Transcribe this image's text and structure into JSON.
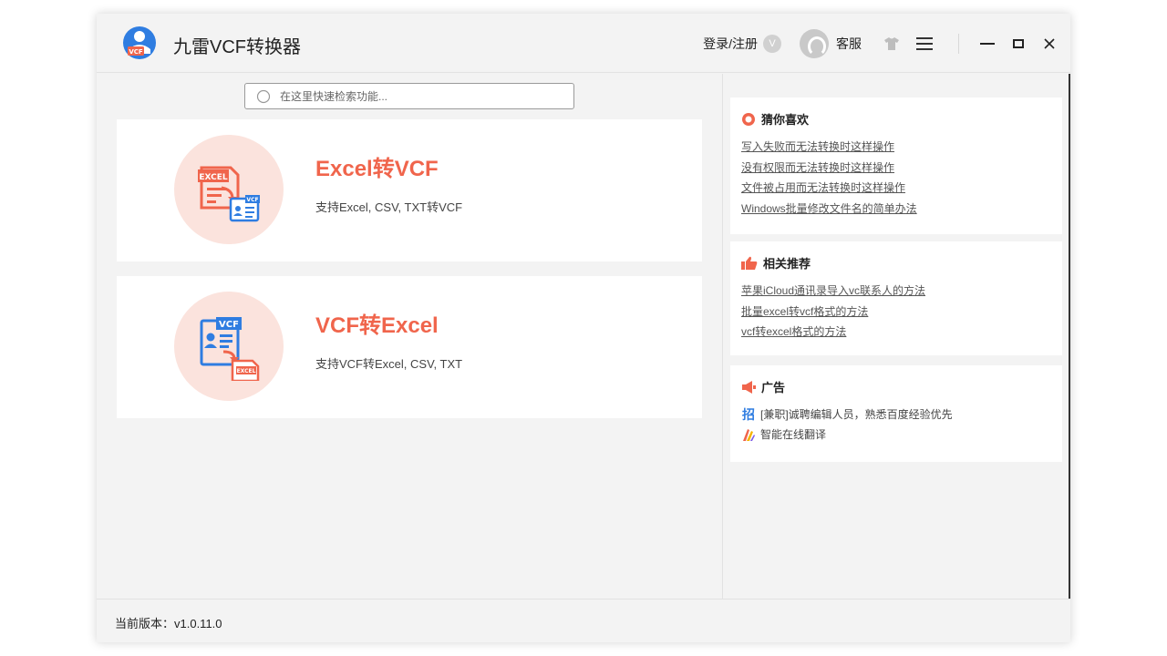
{
  "app": {
    "title": "九雷VCF转换器"
  },
  "header": {
    "login_label": "登录/注册",
    "vip_badge": "V",
    "service_label": "客服"
  },
  "search": {
    "placeholder": "在这里快速检索功能..."
  },
  "cards": [
    {
      "title": "Excel转VCF",
      "desc": "支持Excel, CSV, TXT转VCF",
      "icon_badge_top": "EXCEL",
      "icon_badge_bottom": "VCF"
    },
    {
      "title": "VCF转Excel",
      "desc": "支持VCF转Excel, CSV, TXT",
      "icon_badge_top": "VCF",
      "icon_badge_bottom": "EXCEL"
    }
  ],
  "sidebar": {
    "guess": {
      "title": "猜你喜欢",
      "links": [
        "写入失败而无法转换时这样操作",
        "没有权限而无法转换时这样操作",
        "文件被占用而无法转换时这样操作",
        "Windows批量修改文件名的简单办法"
      ]
    },
    "related": {
      "title": "相关推荐",
      "links": [
        "苹果iCloud通讯录导入vc联系人的方法",
        "批量excel转vcf格式的方法",
        "vcf转excel格式的方法"
      ]
    },
    "ads": {
      "title": "广告",
      "items": [
        {
          "icon_char": "招",
          "text": "[兼职]诚聘编辑人员，熟悉百度经验优先"
        },
        {
          "text": "智能在线翻译"
        }
      ]
    }
  },
  "footer": {
    "version": "当前版本：v1.0.11.0"
  },
  "colors": {
    "accent": "#f0654c",
    "blue": "#2f7de1"
  }
}
